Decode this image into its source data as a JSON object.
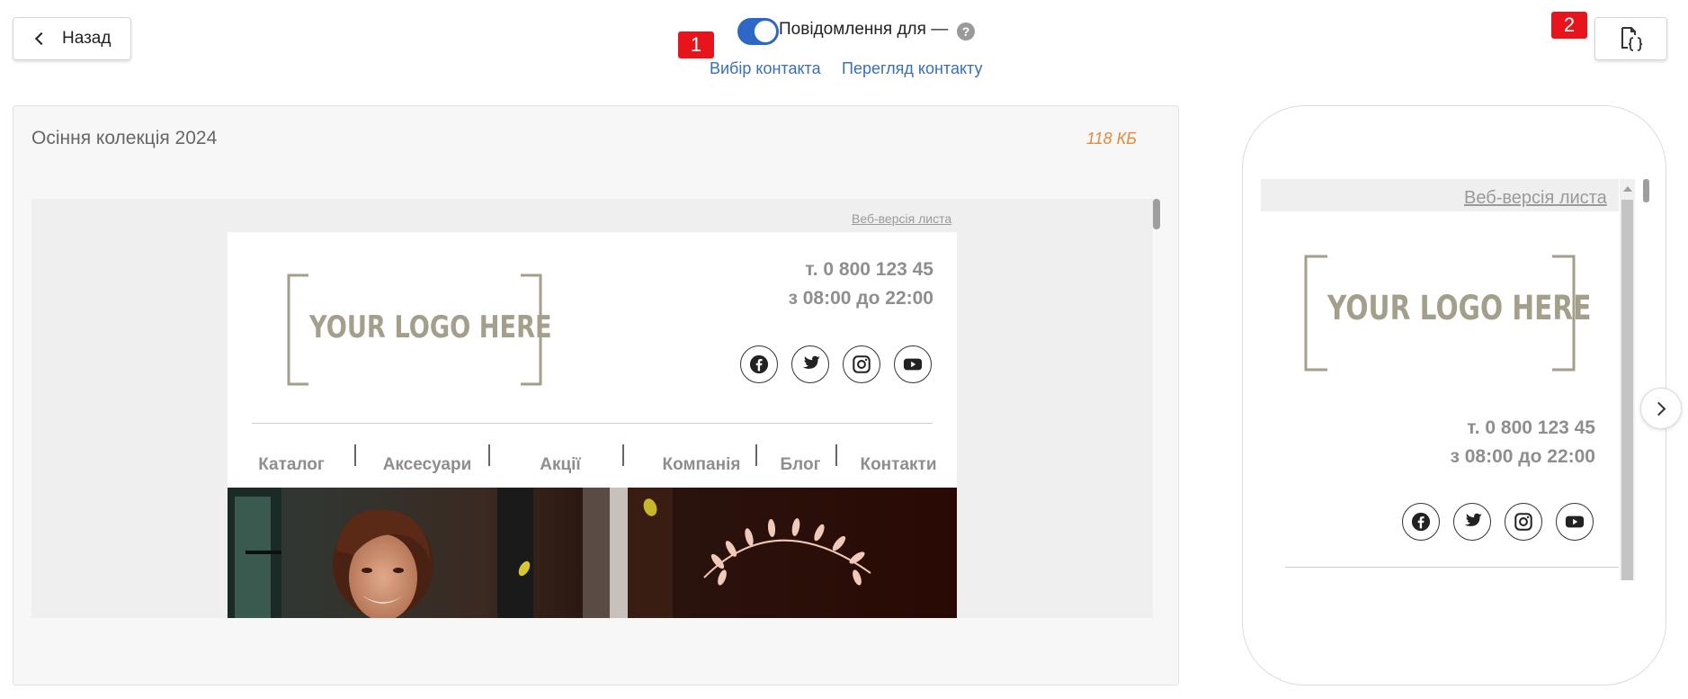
{
  "header": {
    "back_label": "Назад",
    "toggle_on": true,
    "toggle_label": "Повідомлення для —",
    "help_icon": "?",
    "select_contact_link": "Вибір контакта",
    "view_contact_link": "Перегляд контакту",
    "badge_1": "1",
    "badge_2": "2",
    "code_button_icon": "file-code-icon"
  },
  "editor": {
    "campaign_name": "Осіння колекція 2024",
    "size": "118 КБ"
  },
  "email": {
    "web_version": "Веб-версія листа",
    "logo_text": "YOUR LOGO HERE",
    "phone": "т. 0 800 123 45",
    "hours": "з 08:00 до 22:00",
    "social": [
      "facebook-icon",
      "twitter-icon",
      "instagram-icon",
      "youtube-icon"
    ],
    "nav": [
      "Каталог",
      "Аксесуари",
      "Акції",
      "Компанія",
      "Блог",
      "Контакти"
    ]
  },
  "mobile": {
    "web_version": "Веб-версія листа",
    "logo_text": "YOUR LOGO HERE",
    "phone": "т. 0 800 123 45",
    "hours": "з 08:00 до 22:00"
  },
  "colors": {
    "accent": "#2f67c7",
    "link": "#3a6fb4",
    "badge": "#e8141b",
    "size_text": "#e08b3c",
    "logo": "#a39f8a"
  }
}
